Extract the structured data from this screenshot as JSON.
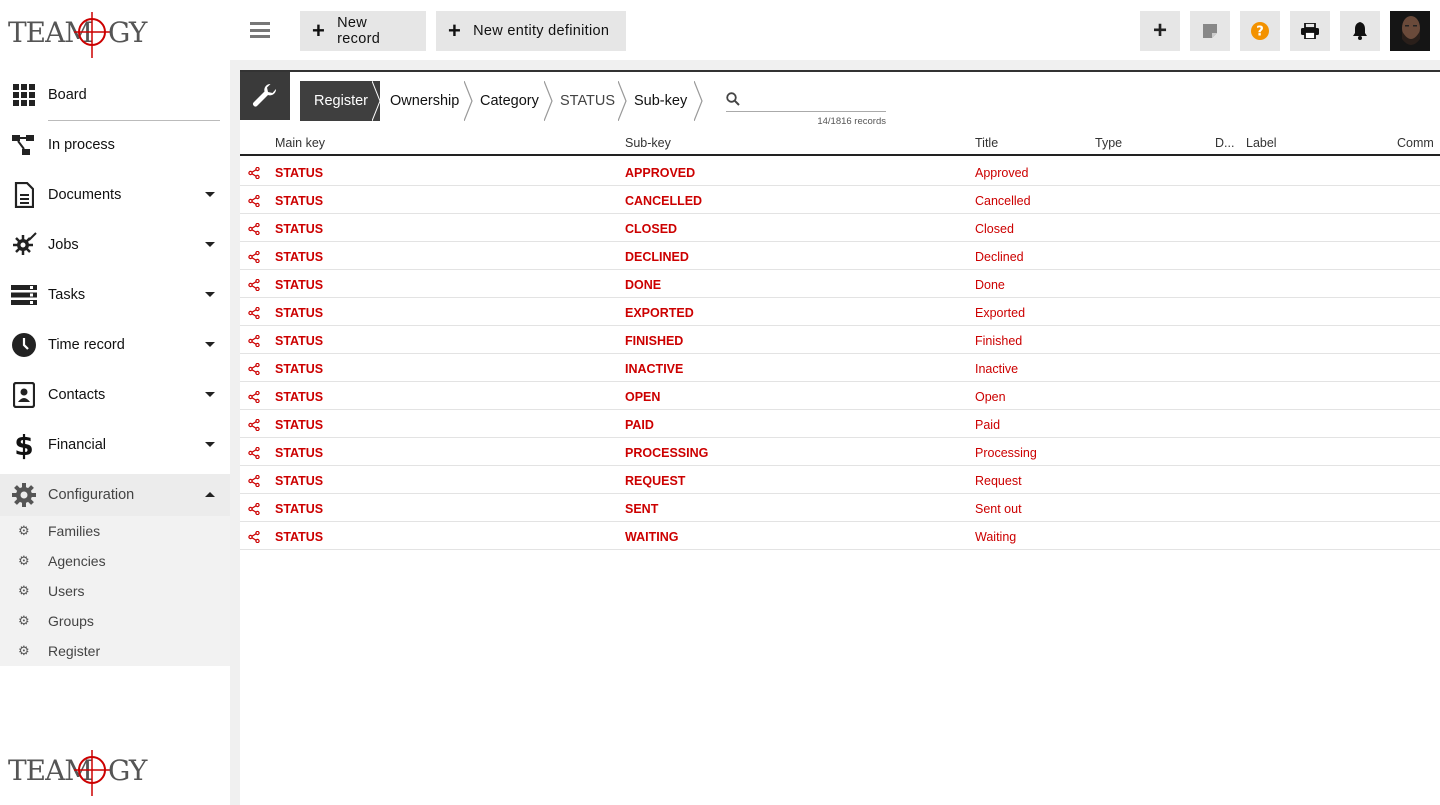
{
  "app": {
    "logo_text": "TEAMOGY"
  },
  "sidebar": {
    "items": [
      {
        "label": "Board",
        "icon": "grid-icon"
      },
      {
        "label": "In process",
        "icon": "workflow-icon"
      },
      {
        "label": "Documents",
        "icon": "document-icon"
      },
      {
        "label": "Jobs",
        "icon": "jobs-icon"
      },
      {
        "label": "Tasks",
        "icon": "tasks-icon"
      },
      {
        "label": "Time record",
        "icon": "clock-icon"
      },
      {
        "label": "Contacts",
        "icon": "contacts-icon"
      },
      {
        "label": "Financial",
        "icon": "dollar-icon"
      },
      {
        "label": "Configuration",
        "icon": "gear-icon"
      }
    ],
    "config_sub": [
      "Families",
      "Agencies",
      "Users",
      "Groups",
      "Register"
    ]
  },
  "toolbar": {
    "new_record": "New record",
    "new_entity": "New entity definition",
    "help_color": "#f39200"
  },
  "breadcrumb": [
    "Register",
    "Ownership",
    "Category",
    "STATUS",
    "Sub-key"
  ],
  "search": {
    "placeholder": "",
    "count": "14/1816 records"
  },
  "table": {
    "headers": [
      "Main key",
      "Sub-key",
      "Title",
      "Type",
      "D...",
      "Label",
      "Comm"
    ],
    "rows": [
      {
        "main": "STATUS",
        "sub": "APPROVED",
        "title": "Approved"
      },
      {
        "main": "STATUS",
        "sub": "CANCELLED",
        "title": "Cancelled"
      },
      {
        "main": "STATUS",
        "sub": "CLOSED",
        "title": "Closed"
      },
      {
        "main": "STATUS",
        "sub": "DECLINED",
        "title": "Declined"
      },
      {
        "main": "STATUS",
        "sub": "DONE",
        "title": "Done"
      },
      {
        "main": "STATUS",
        "sub": "EXPORTED",
        "title": "Exported"
      },
      {
        "main": "STATUS",
        "sub": "FINISHED",
        "title": "Finished"
      },
      {
        "main": "STATUS",
        "sub": "INACTIVE",
        "title": "Inactive"
      },
      {
        "main": "STATUS",
        "sub": "OPEN",
        "title": "Open"
      },
      {
        "main": "STATUS",
        "sub": "PAID",
        "title": "Paid"
      },
      {
        "main": "STATUS",
        "sub": "PROCESSING",
        "title": "Processing"
      },
      {
        "main": "STATUS",
        "sub": "REQUEST",
        "title": "Request"
      },
      {
        "main": "STATUS",
        "sub": "SENT",
        "title": "Sent out"
      },
      {
        "main": "STATUS",
        "sub": "WAITING",
        "title": "Waiting"
      }
    ]
  },
  "colors": {
    "accent_red": "#cc0000",
    "dark": "#3a3a3a"
  }
}
